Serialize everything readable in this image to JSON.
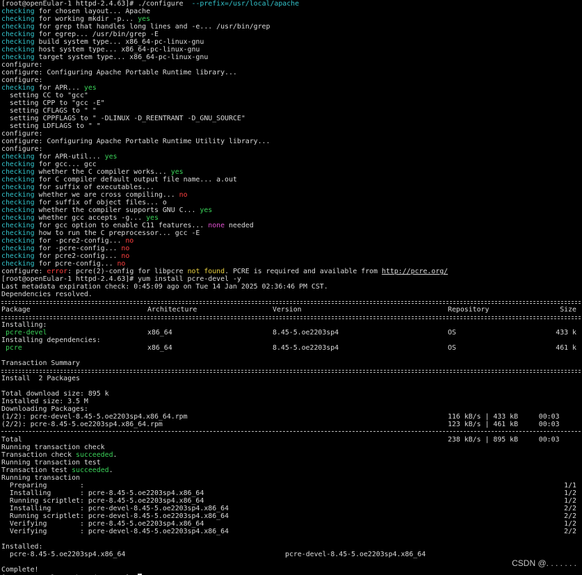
{
  "configure_session": {
    "prompt": "[root@openEular-1 httpd-2.4.63]# ",
    "command": "./configure",
    "command_arg": "--prefix=/usr/local/apache",
    "lines": [
      {
        "lead": "checking",
        "rest": " for chosen layout... Apache"
      },
      {
        "lead": "checking",
        "rest": " for working mkdir -p... ",
        "status": "yes",
        "status_color": "green"
      },
      {
        "lead": "checking",
        "rest": " for grep that handles long lines and -e... /usr/bin/grep"
      },
      {
        "lead": "checking",
        "rest": " for egrep... /usr/bin/grep -E"
      },
      {
        "lead": "checking",
        "rest": " build system type... x86_64-pc-linux-gnu"
      },
      {
        "lead": "checking",
        "rest": " host system type... x86_64-pc-linux-gnu"
      },
      {
        "lead": "checking",
        "rest": " target system type... x86_64-pc-linux-gnu"
      },
      {
        "text": "configure:"
      },
      {
        "text": "configure: Configuring Apache Portable Runtime library..."
      },
      {
        "text": "configure:"
      },
      {
        "lead": "checking",
        "rest": " for APR... ",
        "status": "yes",
        "status_color": "green"
      },
      {
        "text": "  setting CC to \"gcc\""
      },
      {
        "text": "  setting CPP to \"gcc -E\""
      },
      {
        "text": "  setting CFLAGS to \" \""
      },
      {
        "text": "  setting CPPFLAGS to \" -DLINUX -D_REENTRANT -D_GNU_SOURCE\""
      },
      {
        "text": "  setting LDFLAGS to \" \""
      },
      {
        "text": "configure:"
      },
      {
        "text": "configure: Configuring Apache Portable Runtime Utility library..."
      },
      {
        "text": "configure:"
      },
      {
        "lead": "checking",
        "rest": " for APR-util... ",
        "status": "yes",
        "status_color": "green"
      },
      {
        "lead": "checking",
        "rest": " for gcc... gcc"
      },
      {
        "lead": "checking",
        "rest": " whether the C compiler works... ",
        "status": "yes",
        "status_color": "green"
      },
      {
        "lead": "checking",
        "rest": " for C compiler default output file name... a.out"
      },
      {
        "lead": "checking",
        "rest": " for suffix of executables..."
      },
      {
        "lead": "checking",
        "rest": " whether we are cross compiling... ",
        "status": "no",
        "status_color": "red"
      },
      {
        "lead": "checking",
        "rest": " for suffix of object files... o"
      },
      {
        "lead": "checking",
        "rest": " whether the compiler supports GNU C... ",
        "status": "yes",
        "status_color": "green"
      },
      {
        "lead": "checking",
        "rest": " whether gcc accepts -g... ",
        "status": "yes",
        "status_color": "green"
      },
      {
        "lead": "checking",
        "rest": " for gcc option to enable C11 features... ",
        "status": "none",
        "status_color": "magenta",
        "tail": " needed"
      },
      {
        "lead": "checking",
        "rest": " how to run the C preprocessor... gcc -E"
      },
      {
        "lead": "checking",
        "rest": " for -pcre2-config... ",
        "status": "no",
        "status_color": "red"
      },
      {
        "lead": "checking",
        "rest": " for -pcre-config... ",
        "status": "no",
        "status_color": "red"
      },
      {
        "lead": "checking",
        "rest": " for pcre2-config... ",
        "status": "no",
        "status_color": "red"
      },
      {
        "lead": "checking",
        "rest": " for pcre-config... ",
        "status": "no",
        "status_color": "red"
      }
    ],
    "error_line": {
      "prefix": "configure: ",
      "error_word": "error",
      "mid": ": pcre(2)-config for libpcre ",
      "not_found": "not found",
      "after": ". PCRE is required and available from ",
      "link": "http://pcre.org/"
    }
  },
  "yum_session": {
    "prompt": "[root@openEular-1 httpd-2.4.63]# ",
    "command": "yum install pcre-devel -y",
    "metadata_line": "Last metadata expiration check: 0:45:09 ago on Tue 14 Jan 2025 02:36:46 PM CST.",
    "resolved_line": "Dependencies resolved.",
    "table_headers": {
      "package": "Package",
      "arch": "Architecture",
      "version": "Version",
      "repo": "Repository",
      "size": "Size"
    },
    "installing_label": "Installing:",
    "dependencies_label": "Installing dependencies:",
    "rows": [
      {
        "package": " pcre-devel",
        "arch": "x86_64",
        "version": "8.45-5.oe2203sp4",
        "repo": "OS",
        "size": "433 k"
      },
      {
        "package": " pcre",
        "arch": "x86_64",
        "version": "8.45-5.oe2203sp4",
        "repo": "OS",
        "size": "461 k"
      }
    ],
    "summary_title": "Transaction Summary",
    "install_count": "Install  2 Packages",
    "total_download": "Total download size: 895 k",
    "installed_size": "Installed size: 3.5 M",
    "downloading": "Downloading Packages:",
    "downloads": [
      {
        "name": "(1/2): pcre-devel-8.45-5.oe2203sp4.x86_64.rpm",
        "rate": "116 kB/s | 433 kB     00:03"
      },
      {
        "name": "(2/2): pcre-8.45-5.oe2203sp4.x86_64.rpm",
        "rate": "123 kB/s | 461 kB     00:03"
      }
    ],
    "total": {
      "name": "Total",
      "rate": "238 kB/s | 895 kB     00:03"
    },
    "transaction_lines": [
      {
        "text": "Running transaction check"
      },
      {
        "text": "Transaction check ",
        "status": "succeeded",
        "tail": "."
      },
      {
        "text": "Running transaction test"
      },
      {
        "text": "Transaction test ",
        "status": "succeeded",
        "tail": "."
      },
      {
        "text": "Running transaction"
      }
    ],
    "steps": [
      {
        "action": "  Preparing        :",
        "pkg": "",
        "count": "1/1"
      },
      {
        "action": "  Installing       :",
        "pkg": " pcre-8.45-5.oe2203sp4.x86_64",
        "count": "1/2"
      },
      {
        "action": "  Running scriptlet:",
        "pkg": " pcre-8.45-5.oe2203sp4.x86_64",
        "count": "1/2"
      },
      {
        "action": "  Installing       :",
        "pkg": " pcre-devel-8.45-5.oe2203sp4.x86_64",
        "count": "2/2"
      },
      {
        "action": "  Running scriptlet:",
        "pkg": " pcre-devel-8.45-5.oe2203sp4.x86_64",
        "count": "2/2"
      },
      {
        "action": "  Verifying        :",
        "pkg": " pcre-8.45-5.oe2203sp4.x86_64",
        "count": "1/2"
      },
      {
        "action": "  Verifying        :",
        "pkg": " pcre-devel-8.45-5.oe2203sp4.x86_64",
        "count": "2/2"
      }
    ],
    "installed_label": "Installed:",
    "installed": [
      "  pcre-8.45-5.oe2203sp4.x86_64",
      "pcre-devel-8.45-5.oe2203sp4.x86_64"
    ],
    "complete": "Complete!"
  },
  "watermark": "CSDN @. . . . . . .",
  "colors": {
    "background": "#000000",
    "text": "#dcdcdc",
    "cyan": "#33c4cc",
    "green": "#3bd45a",
    "red": "#ff4040",
    "magenta": "#e050d0"
  }
}
